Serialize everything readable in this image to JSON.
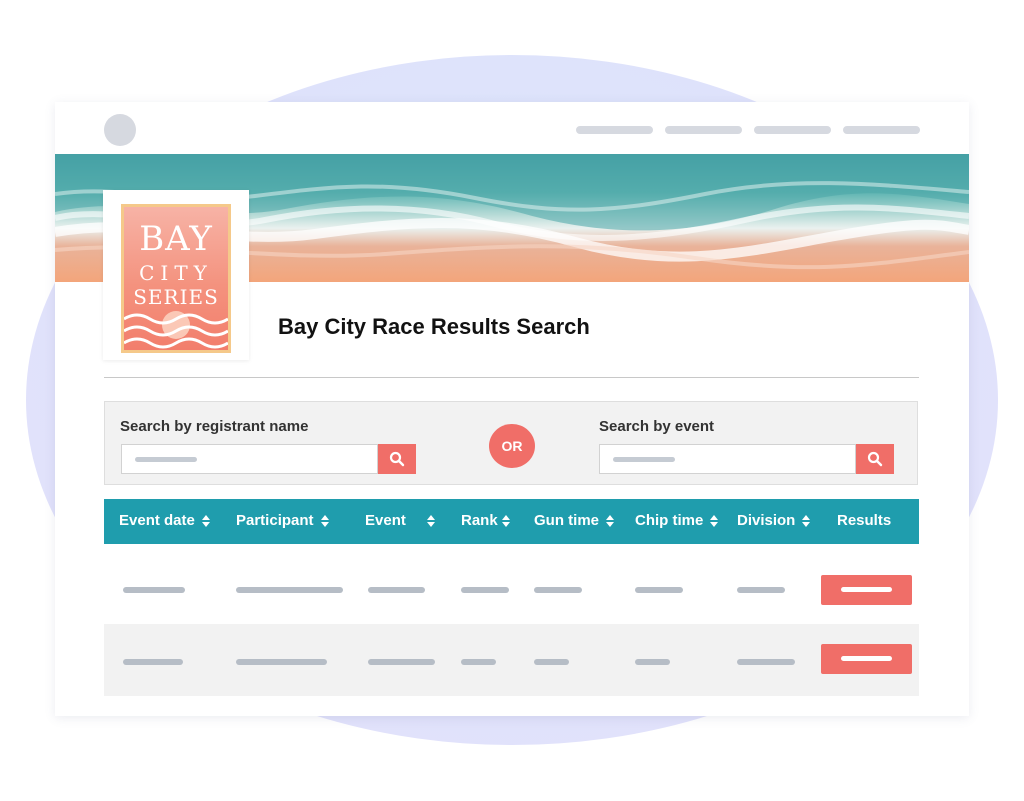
{
  "header": {
    "nav_items": [
      "nav-1",
      "nav-2",
      "nav-3",
      "nav-4"
    ]
  },
  "logo": {
    "line1": "BAY",
    "line2": "CITY",
    "line3": "SERIES"
  },
  "page": {
    "title": "Bay City Race Results Search"
  },
  "search": {
    "by_name_label": "Search by registrant name",
    "or_label": "OR",
    "by_event_label": "Search by event"
  },
  "table": {
    "columns": [
      "Event date",
      "Participant",
      "Event",
      "Rank",
      "Gun time",
      "Chip time",
      "Division",
      "Results"
    ],
    "row_count": 2
  },
  "colors": {
    "accent": "#f06e68",
    "table_header": "#1f9dad",
    "placeholder_bar": "#b6bdc6"
  },
  "icons": [
    "search-icon",
    "sort-icon"
  ]
}
